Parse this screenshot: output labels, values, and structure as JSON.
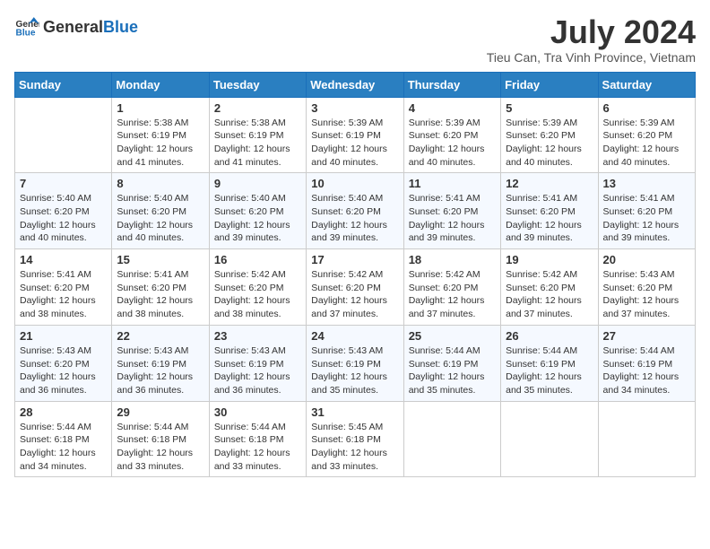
{
  "header": {
    "logo_general": "General",
    "logo_blue": "Blue",
    "title": "July 2024",
    "subtitle": "Tieu Can, Tra Vinh Province, Vietnam"
  },
  "calendar": {
    "days_of_week": [
      "Sunday",
      "Monday",
      "Tuesday",
      "Wednesday",
      "Thursday",
      "Friday",
      "Saturday"
    ],
    "weeks": [
      [
        {
          "day": "",
          "sunrise": "",
          "sunset": "",
          "daylight": ""
        },
        {
          "day": "1",
          "sunrise": "Sunrise: 5:38 AM",
          "sunset": "Sunset: 6:19 PM",
          "daylight": "Daylight: 12 hours and 41 minutes."
        },
        {
          "day": "2",
          "sunrise": "Sunrise: 5:38 AM",
          "sunset": "Sunset: 6:19 PM",
          "daylight": "Daylight: 12 hours and 41 minutes."
        },
        {
          "day": "3",
          "sunrise": "Sunrise: 5:39 AM",
          "sunset": "Sunset: 6:19 PM",
          "daylight": "Daylight: 12 hours and 40 minutes."
        },
        {
          "day": "4",
          "sunrise": "Sunrise: 5:39 AM",
          "sunset": "Sunset: 6:20 PM",
          "daylight": "Daylight: 12 hours and 40 minutes."
        },
        {
          "day": "5",
          "sunrise": "Sunrise: 5:39 AM",
          "sunset": "Sunset: 6:20 PM",
          "daylight": "Daylight: 12 hours and 40 minutes."
        },
        {
          "day": "6",
          "sunrise": "Sunrise: 5:39 AM",
          "sunset": "Sunset: 6:20 PM",
          "daylight": "Daylight: 12 hours and 40 minutes."
        }
      ],
      [
        {
          "day": "7",
          "sunrise": "Sunrise: 5:40 AM",
          "sunset": "Sunset: 6:20 PM",
          "daylight": "Daylight: 12 hours and 40 minutes."
        },
        {
          "day": "8",
          "sunrise": "Sunrise: 5:40 AM",
          "sunset": "Sunset: 6:20 PM",
          "daylight": "Daylight: 12 hours and 40 minutes."
        },
        {
          "day": "9",
          "sunrise": "Sunrise: 5:40 AM",
          "sunset": "Sunset: 6:20 PM",
          "daylight": "Daylight: 12 hours and 39 minutes."
        },
        {
          "day": "10",
          "sunrise": "Sunrise: 5:40 AM",
          "sunset": "Sunset: 6:20 PM",
          "daylight": "Daylight: 12 hours and 39 minutes."
        },
        {
          "day": "11",
          "sunrise": "Sunrise: 5:41 AM",
          "sunset": "Sunset: 6:20 PM",
          "daylight": "Daylight: 12 hours and 39 minutes."
        },
        {
          "day": "12",
          "sunrise": "Sunrise: 5:41 AM",
          "sunset": "Sunset: 6:20 PM",
          "daylight": "Daylight: 12 hours and 39 minutes."
        },
        {
          "day": "13",
          "sunrise": "Sunrise: 5:41 AM",
          "sunset": "Sunset: 6:20 PM",
          "daylight": "Daylight: 12 hours and 39 minutes."
        }
      ],
      [
        {
          "day": "14",
          "sunrise": "Sunrise: 5:41 AM",
          "sunset": "Sunset: 6:20 PM",
          "daylight": "Daylight: 12 hours and 38 minutes."
        },
        {
          "day": "15",
          "sunrise": "Sunrise: 5:41 AM",
          "sunset": "Sunset: 6:20 PM",
          "daylight": "Daylight: 12 hours and 38 minutes."
        },
        {
          "day": "16",
          "sunrise": "Sunrise: 5:42 AM",
          "sunset": "Sunset: 6:20 PM",
          "daylight": "Daylight: 12 hours and 38 minutes."
        },
        {
          "day": "17",
          "sunrise": "Sunrise: 5:42 AM",
          "sunset": "Sunset: 6:20 PM",
          "daylight": "Daylight: 12 hours and 37 minutes."
        },
        {
          "day": "18",
          "sunrise": "Sunrise: 5:42 AM",
          "sunset": "Sunset: 6:20 PM",
          "daylight": "Daylight: 12 hours and 37 minutes."
        },
        {
          "day": "19",
          "sunrise": "Sunrise: 5:42 AM",
          "sunset": "Sunset: 6:20 PM",
          "daylight": "Daylight: 12 hours and 37 minutes."
        },
        {
          "day": "20",
          "sunrise": "Sunrise: 5:43 AM",
          "sunset": "Sunset: 6:20 PM",
          "daylight": "Daylight: 12 hours and 37 minutes."
        }
      ],
      [
        {
          "day": "21",
          "sunrise": "Sunrise: 5:43 AM",
          "sunset": "Sunset: 6:20 PM",
          "daylight": "Daylight: 12 hours and 36 minutes."
        },
        {
          "day": "22",
          "sunrise": "Sunrise: 5:43 AM",
          "sunset": "Sunset: 6:19 PM",
          "daylight": "Daylight: 12 hours and 36 minutes."
        },
        {
          "day": "23",
          "sunrise": "Sunrise: 5:43 AM",
          "sunset": "Sunset: 6:19 PM",
          "daylight": "Daylight: 12 hours and 36 minutes."
        },
        {
          "day": "24",
          "sunrise": "Sunrise: 5:43 AM",
          "sunset": "Sunset: 6:19 PM",
          "daylight": "Daylight: 12 hours and 35 minutes."
        },
        {
          "day": "25",
          "sunrise": "Sunrise: 5:44 AM",
          "sunset": "Sunset: 6:19 PM",
          "daylight": "Daylight: 12 hours and 35 minutes."
        },
        {
          "day": "26",
          "sunrise": "Sunrise: 5:44 AM",
          "sunset": "Sunset: 6:19 PM",
          "daylight": "Daylight: 12 hours and 35 minutes."
        },
        {
          "day": "27",
          "sunrise": "Sunrise: 5:44 AM",
          "sunset": "Sunset: 6:19 PM",
          "daylight": "Daylight: 12 hours and 34 minutes."
        }
      ],
      [
        {
          "day": "28",
          "sunrise": "Sunrise: 5:44 AM",
          "sunset": "Sunset: 6:18 PM",
          "daylight": "Daylight: 12 hours and 34 minutes."
        },
        {
          "day": "29",
          "sunrise": "Sunrise: 5:44 AM",
          "sunset": "Sunset: 6:18 PM",
          "daylight": "Daylight: 12 hours and 33 minutes."
        },
        {
          "day": "30",
          "sunrise": "Sunrise: 5:44 AM",
          "sunset": "Sunset: 6:18 PM",
          "daylight": "Daylight: 12 hours and 33 minutes."
        },
        {
          "day": "31",
          "sunrise": "Sunrise: 5:45 AM",
          "sunset": "Sunset: 6:18 PM",
          "daylight": "Daylight: 12 hours and 33 minutes."
        },
        {
          "day": "",
          "sunrise": "",
          "sunset": "",
          "daylight": ""
        },
        {
          "day": "",
          "sunrise": "",
          "sunset": "",
          "daylight": ""
        },
        {
          "day": "",
          "sunrise": "",
          "sunset": "",
          "daylight": ""
        }
      ]
    ]
  }
}
